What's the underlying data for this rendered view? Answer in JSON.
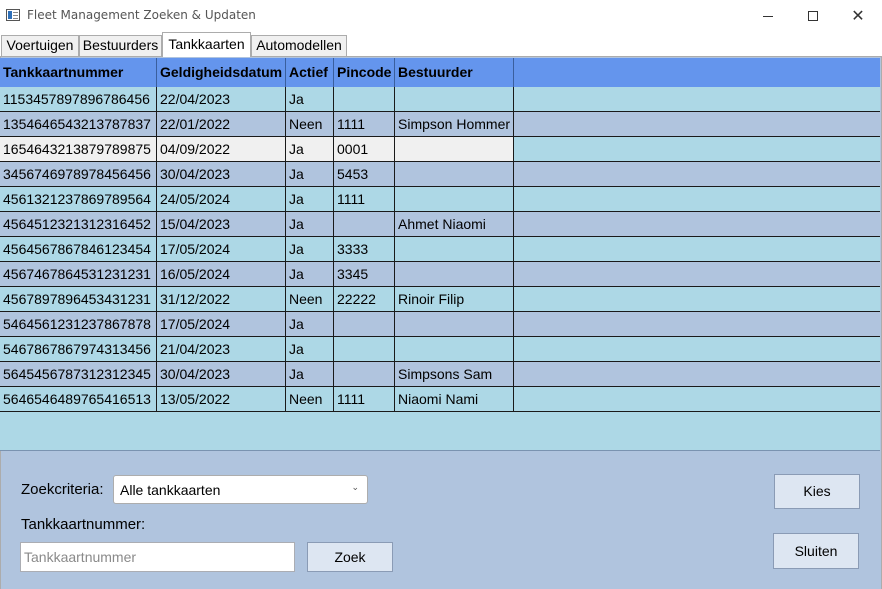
{
  "window": {
    "title": "Fleet Management Zoeken & Updaten",
    "icon": "app-window-icon",
    "controls": {
      "minimize": "minimize-icon",
      "maximize": "maximize-icon",
      "close": "close-icon"
    }
  },
  "tabs": [
    {
      "label": "Voertuigen",
      "active": false
    },
    {
      "label": "Bestuurders",
      "active": false
    },
    {
      "label": "Tankkaarten",
      "active": true
    },
    {
      "label": "Automodellen",
      "active": false
    }
  ],
  "grid": {
    "columns": [
      "Tankkaartnummer",
      "Geldigheidsdatum",
      "Actief",
      "Pincode",
      "Bestuurder"
    ],
    "rows": [
      [
        "1153457897896786456",
        "22/04/2023",
        "Ja",
        "",
        ""
      ],
      [
        "1354646543213787837",
        "22/01/2022",
        "Neen",
        "1111",
        "Simpson Hommer"
      ],
      [
        "1654643213879789875",
        "04/09/2022",
        "Ja",
        "0001",
        ""
      ],
      [
        "3456746978978456456",
        "30/04/2023",
        "Ja",
        "5453",
        ""
      ],
      [
        "4561321237869789564",
        "24/05/2024",
        "Ja",
        "1111",
        ""
      ],
      [
        "4564512321312316452",
        "15/04/2023",
        "Ja",
        "",
        "Ahmet Niaomi"
      ],
      [
        "4564567867846123454",
        "17/05/2024",
        "Ja",
        "3333",
        ""
      ],
      [
        "4567467864531231231",
        "16/05/2024",
        "Ja",
        "3345",
        ""
      ],
      [
        "4567897896453431231",
        "31/12/2022",
        "Neen",
        "22222",
        "Rinoir Filip"
      ],
      [
        "5464561231237867878",
        "17/05/2024",
        "Ja",
        "",
        ""
      ],
      [
        "5467867867974313456",
        "21/04/2023",
        "Ja",
        "",
        ""
      ],
      [
        "5645456787312312345",
        "30/04/2023",
        "Ja",
        "",
        "Simpsons Sam"
      ],
      [
        "5646546489765416513",
        "13/05/2022",
        "Neen",
        "1111",
        "Niaomi Nami"
      ]
    ],
    "selected_row": 2
  },
  "form": {
    "criteria_label": "Zoekcriteria:",
    "criteria_value": "Alle tankkaarten",
    "number_label": "Tankkaartnummer:",
    "number_placeholder": "Tankkaartnummer",
    "number_value": "",
    "search_button": "Zoek",
    "choose_button": "Kies",
    "close_button": "Sluiten"
  },
  "colors": {
    "header": "#6495ed",
    "row_light": "#add8e6",
    "row_dark": "#b0c4de",
    "panel": "#b0c4de",
    "selected_cell": "#f0f0f0"
  }
}
